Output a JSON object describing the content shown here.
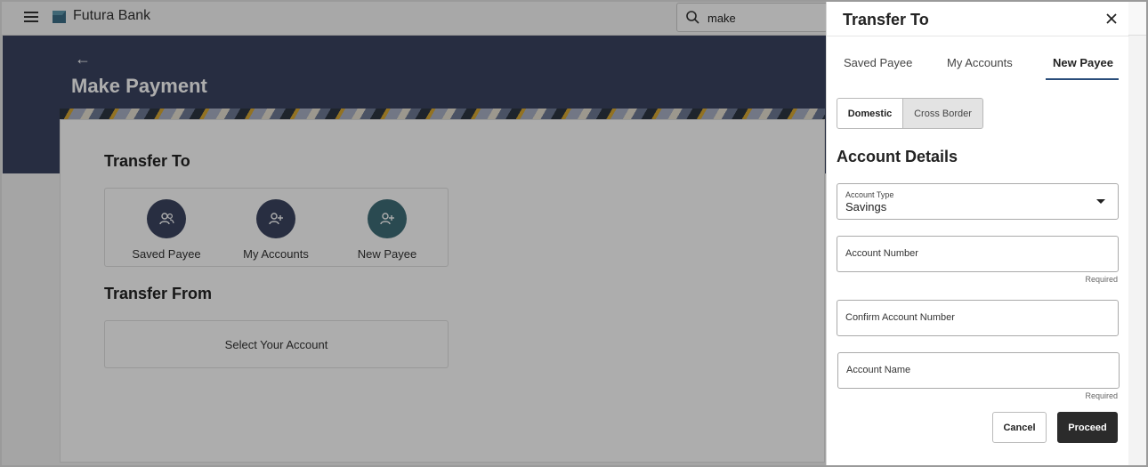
{
  "header": {
    "brand_name": "Futura Bank",
    "search_value": "make"
  },
  "page": {
    "title": "Make Payment",
    "back_icon": "arrow-left-icon"
  },
  "transfer_to": {
    "title": "Transfer To",
    "options": [
      {
        "label": "Saved Payee",
        "icon": "users-icon",
        "color": "#3b4560"
      },
      {
        "label": "My Accounts",
        "icon": "user-plus-icon",
        "color": "#3b4560"
      },
      {
        "label": "New Payee",
        "icon": "user-plus-icon",
        "color": "#3e6e78"
      }
    ]
  },
  "transfer_from": {
    "title": "Transfer From",
    "select_label": "Select Your Account"
  },
  "panel": {
    "title": "Transfer To",
    "tabs": [
      {
        "label": "Saved Payee",
        "active": false
      },
      {
        "label": "My Accounts",
        "active": false
      },
      {
        "label": "New Payee",
        "active": true
      }
    ],
    "segments": {
      "domestic": "Domestic",
      "cross_border": "Cross Border",
      "active": "Domestic"
    },
    "account_details_title": "Account Details",
    "fields": {
      "account_type": {
        "label": "Account Type",
        "value": "Savings"
      },
      "account_number": {
        "placeholder": "Account Number",
        "hint": "Required"
      },
      "confirm_account_number": {
        "placeholder": "Confirm Account Number"
      },
      "account_name": {
        "placeholder": "Account Name",
        "hint": "Required"
      }
    },
    "buttons": {
      "cancel": "Cancel",
      "proceed": "Proceed"
    }
  },
  "colors": {
    "hero": "#3a4360",
    "accent_tab": "#2a4d7a",
    "proceed_button": "#2b2b2b"
  }
}
